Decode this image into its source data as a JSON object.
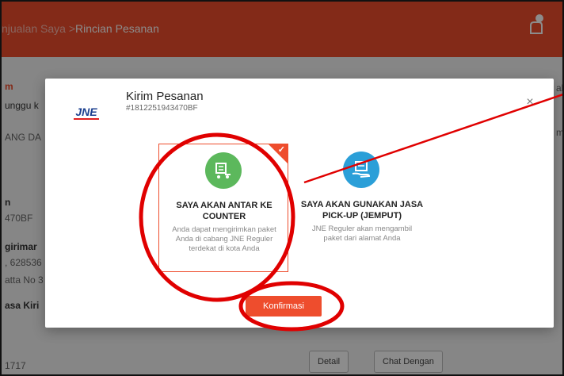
{
  "header": {
    "breadcrumb_parent": "njualan Saya",
    "breadcrumb_sep": " >",
    "breadcrumb_current": "Rincian Pesanan"
  },
  "background": {
    "t1": "m",
    "t2": "unggu k",
    "t3": "ANG DA",
    "t4": "n",
    "t5": "470BF",
    "t6": "girimar",
    "t7": ", 628536",
    "t8": "atta No 3",
    "t9": "asa Kiri",
    "t10": "1717",
    "right1": "al",
    "right2": "m",
    "btn1": "Detail",
    "btn2": "Chat Dengan"
  },
  "modal": {
    "title": "Kirim Pesanan",
    "order_id": "#1812251943470BF",
    "logo_text": "JNE",
    "close": "×",
    "options": [
      {
        "title": "SAYA AKAN ANTAR KE COUNTER",
        "desc": "Anda dapat mengirimkan paket Anda di cabang JNE Reguler terdekat di kota Anda",
        "icon": "cart-icon",
        "color": "#5cb85c",
        "selected": true
      },
      {
        "title": "SAYA AKAN GUNAKAN JASA PICK-UP (JEMPUT)",
        "desc": "JNE Reguler akan mengambil paket dari alamat Anda",
        "icon": "box-hand-icon",
        "color": "#2b9fd8",
        "selected": false
      }
    ],
    "confirm_label": "Konfirmasi"
  },
  "colors": {
    "brand": "#ee4d2d",
    "annotation": "#e00000"
  }
}
